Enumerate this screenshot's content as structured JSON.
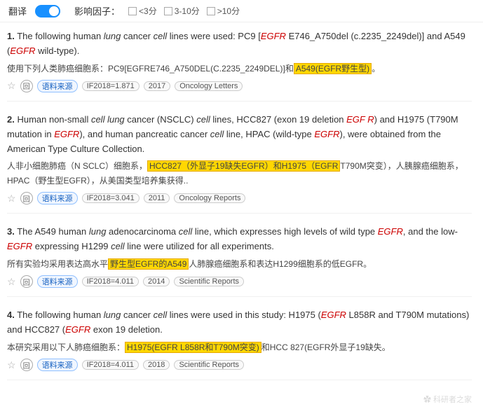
{
  "topbar": {
    "translate_label": "翻译",
    "toggle_state": "on",
    "influence_label": "影响因子：",
    "filters": [
      {
        "label": "<3分",
        "checked": false
      },
      {
        "label": "3-10分",
        "checked": false
      },
      {
        "label": ">10分",
        "checked": false
      }
    ]
  },
  "results": [
    {
      "number": "1.",
      "en_parts": [
        {
          "text": "The following human ",
          "type": "normal"
        },
        {
          "text": "lung",
          "type": "italic"
        },
        {
          "text": " cancer ",
          "type": "normal"
        },
        {
          "text": "cell",
          "type": "italic"
        },
        {
          "text": " lines were used: PC9 [",
          "type": "normal"
        },
        {
          "text": "EGFR",
          "type": "highlight-italic"
        },
        {
          "text": " E746_A750del (c.2235_2249del)] and A549 (",
          "type": "normal"
        },
        {
          "text": "EGFR",
          "type": "highlight-italic"
        },
        {
          "text": " wild-type).",
          "type": "normal"
        }
      ],
      "zh_parts": [
        {
          "text": "使用下列人类肺癌细胞系：PC9[EGFRE746_A750DEL(C.2235_2249DEL)]和",
          "type": "normal"
        },
        {
          "text": "A549(EGFR野生型)",
          "type": "highlight-box"
        },
        {
          "text": "。",
          "type": "normal"
        }
      ],
      "meta": {
        "if_value": "IF2018=1.871",
        "year": "2017",
        "journal": "Oncology Letters"
      }
    },
    {
      "number": "2.",
      "en_parts": [
        {
          "text": "Human non-small ",
          "type": "normal"
        },
        {
          "text": "cell lung",
          "type": "italic"
        },
        {
          "text": " cancer (NSCLC) ",
          "type": "normal"
        },
        {
          "text": "cell",
          "type": "italic"
        },
        {
          "text": " lines, HCC827 (exon 19 deletion ",
          "type": "normal"
        },
        {
          "text": "EGF R",
          "type": "highlight-italic"
        },
        {
          "text": ") and H1975 (T790M mutation in ",
          "type": "normal"
        },
        {
          "text": "EGFR",
          "type": "highlight-italic"
        },
        {
          "text": "), and human pancreatic cancer ",
          "type": "normal"
        },
        {
          "text": "cell",
          "type": "italic"
        },
        {
          "text": " line, HPAC (wild-type ",
          "type": "normal"
        },
        {
          "text": "EGFR",
          "type": "highlight-italic"
        },
        {
          "text": "), were obtained from the American Type Culture Collection.",
          "type": "normal"
        }
      ],
      "zh_parts": [
        {
          "text": "人非小细胞肺癌（N SCLC）细胞系，",
          "type": "normal"
        },
        {
          "text": "HCC827（外显子19缺失EGFR）和H1975（EGFR",
          "type": "highlight-box"
        },
        {
          "text": "T790M突变），人胰腺癌细胞系，HPAC（野生型EGFR），从美国类型培养集获得..",
          "type": "normal"
        }
      ],
      "meta": {
        "if_value": "IF2018=3.041",
        "year": "2011",
        "journal": "Oncology Reports"
      }
    },
    {
      "number": "3.",
      "en_parts": [
        {
          "text": "The A549 human ",
          "type": "normal"
        },
        {
          "text": "lung",
          "type": "italic"
        },
        {
          "text": " adenocarcinoma ",
          "type": "normal"
        },
        {
          "text": "cell",
          "type": "italic"
        },
        {
          "text": " line, which expresses high levels of wild type ",
          "type": "normal"
        },
        {
          "text": "EGFR",
          "type": "highlight-italic"
        },
        {
          "text": ", and the low-",
          "type": "normal"
        },
        {
          "text": "EGFR",
          "type": "highlight-italic"
        },
        {
          "text": " expressing H1299 ",
          "type": "normal"
        },
        {
          "text": "cell",
          "type": "italic"
        },
        {
          "text": " line were utilized for all experiments.",
          "type": "normal"
        }
      ],
      "zh_parts": [
        {
          "text": "所有实验均采用表达高水平",
          "type": "normal"
        },
        {
          "text": "野生型EGFR的A549",
          "type": "highlight-box"
        },
        {
          "text": "人肺腺癌细胞系和表达H1299细胞系的低EGFR。",
          "type": "normal"
        }
      ],
      "meta": {
        "if_value": "IF2018=4.011",
        "year": "2014",
        "journal": "Scientific Reports"
      }
    },
    {
      "number": "4.",
      "en_parts": [
        {
          "text": "The following human ",
          "type": "normal"
        },
        {
          "text": "lung",
          "type": "italic"
        },
        {
          "text": " cancer ",
          "type": "normal"
        },
        {
          "text": "cell",
          "type": "italic"
        },
        {
          "text": " lines were used in this study: H1975 (",
          "type": "normal"
        },
        {
          "text": "EGFR",
          "type": "highlight-italic"
        },
        {
          "text": " L858R and T790M mutations) and HCC827 (",
          "type": "normal"
        },
        {
          "text": "EGFR",
          "type": "highlight-italic"
        },
        {
          "text": " exon 19 deletion.",
          "type": "normal"
        }
      ],
      "zh_parts": [
        {
          "text": "本研究采用以下人肺癌细胞系：",
          "type": "normal"
        },
        {
          "text": "H1975(EGFR L858R和T790M突变)",
          "type": "highlight-box"
        },
        {
          "text": "和HCC 827(EGFR外显子19缺失。",
          "type": "normal"
        }
      ],
      "meta": {
        "if_value": "IF2018=4.011",
        "year": "2018",
        "journal": "Scientific Reports"
      }
    }
  ],
  "watermark": "科研者之家"
}
